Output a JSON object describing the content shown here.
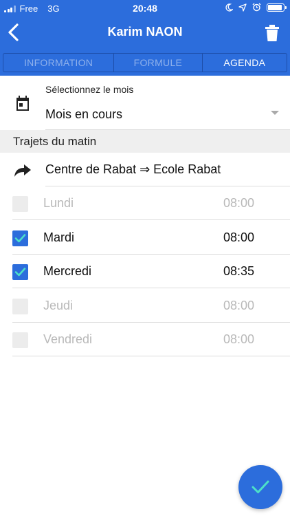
{
  "status_bar": {
    "carrier": "Free",
    "network": "3G",
    "time": "20:48"
  },
  "header": {
    "title": "Karim NAON"
  },
  "tabs": [
    {
      "label": "INFORMATION",
      "active": false
    },
    {
      "label": "FORMULE",
      "active": false
    },
    {
      "label": "AGENDA",
      "active": true
    }
  ],
  "month_select": {
    "label": "Sélectionnez le mois",
    "value": "Mois en cours"
  },
  "section": {
    "title": "Trajets du matin"
  },
  "route": {
    "text": "Centre de Rabat ⇒ Ecole Rabat"
  },
  "days": [
    {
      "name": "Lundi",
      "time": "08:00",
      "checked": false
    },
    {
      "name": "Mardi",
      "time": "08:00",
      "checked": true
    },
    {
      "name": "Mercredi",
      "time": "08:35",
      "checked": true
    },
    {
      "name": "Jeudi",
      "time": "08:00",
      "checked": false
    },
    {
      "name": "Vendredi",
      "time": "08:00",
      "checked": false
    }
  ],
  "colors": {
    "primary": "#2c6ddc",
    "check_mark": "#4de0c8",
    "disabled_text": "#b9b9b9"
  },
  "icons": {
    "back": "chevron-left-icon",
    "delete": "trash-icon",
    "calendar": "calendar-icon",
    "route": "share-arrow-icon",
    "confirm": "checkmark-icon"
  }
}
